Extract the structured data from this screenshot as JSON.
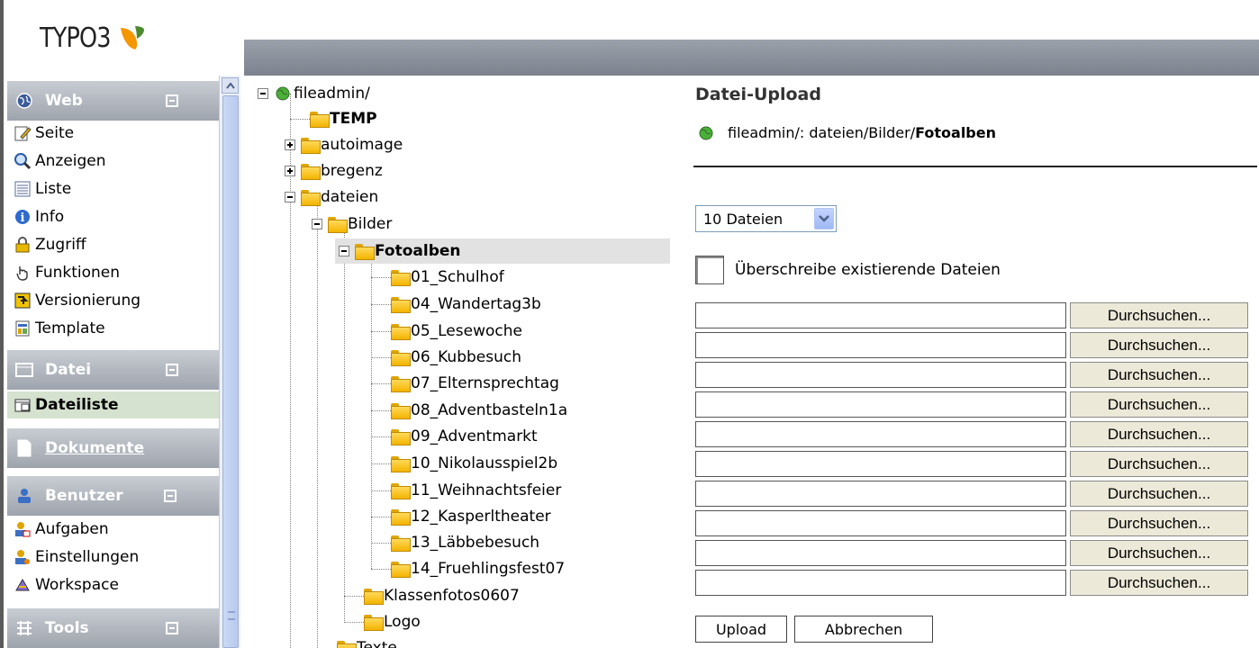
{
  "logo": {
    "text": "TYPO3"
  },
  "modules": [
    {
      "label": "Web",
      "icon": "globe-icon",
      "items": [
        {
          "label": "Seite",
          "icon": "page-edit-icon"
        },
        {
          "label": "Anzeigen",
          "icon": "magnifier-icon"
        },
        {
          "label": "Liste",
          "icon": "list-icon"
        },
        {
          "label": "Info",
          "icon": "info-icon"
        },
        {
          "label": "Zugriff",
          "icon": "lock-icon"
        },
        {
          "label": "Funktionen",
          "icon": "hand-icon"
        },
        {
          "label": "Versionierung",
          "icon": "versioning-icon"
        },
        {
          "label": "Template",
          "icon": "template-icon"
        }
      ]
    },
    {
      "label": "Datei",
      "icon": "file-icon",
      "items": [
        {
          "label": "Dateiliste",
          "icon": "filelist-icon",
          "active": true
        }
      ]
    },
    {
      "label": "Dokumente",
      "icon": "document-icon",
      "items": []
    },
    {
      "label": "Benutzer",
      "icon": "user-icon",
      "items": [
        {
          "label": "Aufgaben",
          "icon": "tasks-icon"
        },
        {
          "label": "Einstellungen",
          "icon": "settings-icon"
        },
        {
          "label": "Workspace",
          "icon": "workspace-icon"
        }
      ]
    },
    {
      "label": "Tools",
      "icon": "tools-icon",
      "items": []
    }
  ],
  "tree": {
    "root": "fileadmin/",
    "nodes": [
      {
        "label": "TEMP",
        "bold": true
      },
      {
        "label": "autoimage"
      },
      {
        "label": "bregenz"
      },
      {
        "label": "dateien"
      },
      {
        "label": "Bilder"
      },
      {
        "label": "Fotoalben",
        "bold": true,
        "selected": true
      },
      {
        "label": "01_Schulhof"
      },
      {
        "label": "04_Wandertag3b"
      },
      {
        "label": "05_Lesewoche"
      },
      {
        "label": "06_Kubbesuch"
      },
      {
        "label": "07_Elternsprechtag"
      },
      {
        "label": "08_Adventbasteln1a"
      },
      {
        "label": "09_Adventmarkt"
      },
      {
        "label": "10_Nikolausspiel2b"
      },
      {
        "label": "11_Weihnachtsfeier"
      },
      {
        "label": "12_Kasperltheater"
      },
      {
        "label": "13_Läbbebesuch"
      },
      {
        "label": "14_Fruehlingsfest07"
      },
      {
        "label": "Klassenfotos0607"
      },
      {
        "label": "Logo"
      },
      {
        "label": "Texte"
      }
    ]
  },
  "upload": {
    "title": "Datei-Upload",
    "path_prefix": "fileadmin/: dateien/Bilder/",
    "path_current": "Fotoalben",
    "count_select": "10 Dateien",
    "overwrite_label": "Überschreibe existierende Dateien",
    "browse_label": "Durchsuchen...",
    "upload_button": "Upload",
    "cancel_button": "Abbrechen"
  }
}
